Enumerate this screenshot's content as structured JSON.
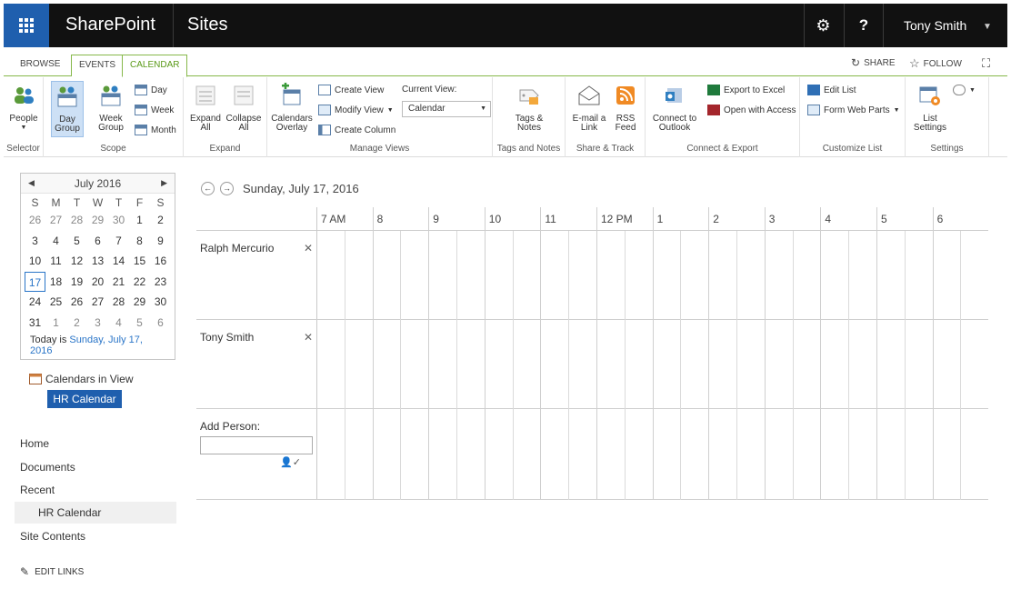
{
  "suite": {
    "brand": "SharePoint",
    "site": "Sites",
    "user": "Tony Smith",
    "help": "?",
    "gear_icon": "gear-icon"
  },
  "tabs": {
    "browse": "BROWSE",
    "events": "EVENTS",
    "calendar": "CALENDAR",
    "share": "SHARE",
    "follow": "FOLLOW"
  },
  "ribbon": {
    "selector": {
      "people": "People",
      "label": "Selector"
    },
    "scope": {
      "day_group": [
        "Day",
        "Group"
      ],
      "week_group": [
        "Week",
        "Group"
      ],
      "day": "Day",
      "week": "Week",
      "month": "Month",
      "label": "Scope"
    },
    "expand": {
      "expand_all": [
        "Expand",
        "All"
      ],
      "collapse_all": [
        "Collapse",
        "All"
      ],
      "label": "Expand"
    },
    "manage": {
      "calendars_overlay": [
        "Calendars",
        "Overlay"
      ],
      "create_view": "Create View",
      "modify_view": "Modify View",
      "create_column": "Create Column",
      "current_view_label": "Current View:",
      "current_view_value": "Calendar",
      "label": "Manage Views"
    },
    "tags": {
      "tags_notes": [
        "Tags &",
        "Notes"
      ],
      "label": "Tags and Notes"
    },
    "share": {
      "email_link": [
        "E-mail a",
        "Link"
      ],
      "rss_feed": [
        "RSS",
        "Feed"
      ],
      "label": "Share & Track"
    },
    "connect": {
      "connect_outlook": [
        "Connect to",
        "Outlook"
      ],
      "export_excel": "Export to Excel",
      "open_access": "Open with Access",
      "label": "Connect & Export"
    },
    "customize": {
      "edit_list": "Edit List",
      "form_web_parts": "Form Web Parts",
      "label": "Customize List"
    },
    "settings": {
      "list_settings": [
        "List",
        "Settings"
      ],
      "label": "Settings"
    }
  },
  "mini_calendar": {
    "month": "July 2016",
    "dow": [
      "S",
      "M",
      "T",
      "W",
      "T",
      "F",
      "S"
    ],
    "weeks": [
      [
        "26",
        "27",
        "28",
        "29",
        "30",
        "1",
        "2"
      ],
      [
        "3",
        "4",
        "5",
        "6",
        "7",
        "8",
        "9"
      ],
      [
        "10",
        "11",
        "12",
        "13",
        "14",
        "15",
        "16"
      ],
      [
        "17",
        "18",
        "19",
        "20",
        "21",
        "22",
        "23"
      ],
      [
        "24",
        "25",
        "26",
        "27",
        "28",
        "29",
        "30"
      ],
      [
        "31",
        "1",
        "2",
        "3",
        "4",
        "5",
        "6"
      ]
    ],
    "today_prefix": "Today is",
    "today_link": "Sunday, July 17, 2016"
  },
  "calendars_in_view": {
    "label": "Calendars in View",
    "calendar": "HR Calendar"
  },
  "nav": {
    "home": "Home",
    "documents": "Documents",
    "recent": "Recent",
    "recent_item": "HR Calendar",
    "site_contents": "Site Contents",
    "edit_links": "EDIT LINKS"
  },
  "view": {
    "date": "Sunday, July 17, 2016",
    "hours": [
      "7 AM",
      "8",
      "9",
      "10",
      "11",
      "12 PM",
      "1",
      "2",
      "3",
      "4",
      "5",
      "6"
    ],
    "people": [
      "Ralph Mercurio",
      "Tony Smith"
    ],
    "add_person_label": "Add Person:"
  },
  "colors": {
    "accent_green": "#86b84a",
    "accent_blue": "#1f5fae",
    "link_blue": "#2a75c8"
  }
}
